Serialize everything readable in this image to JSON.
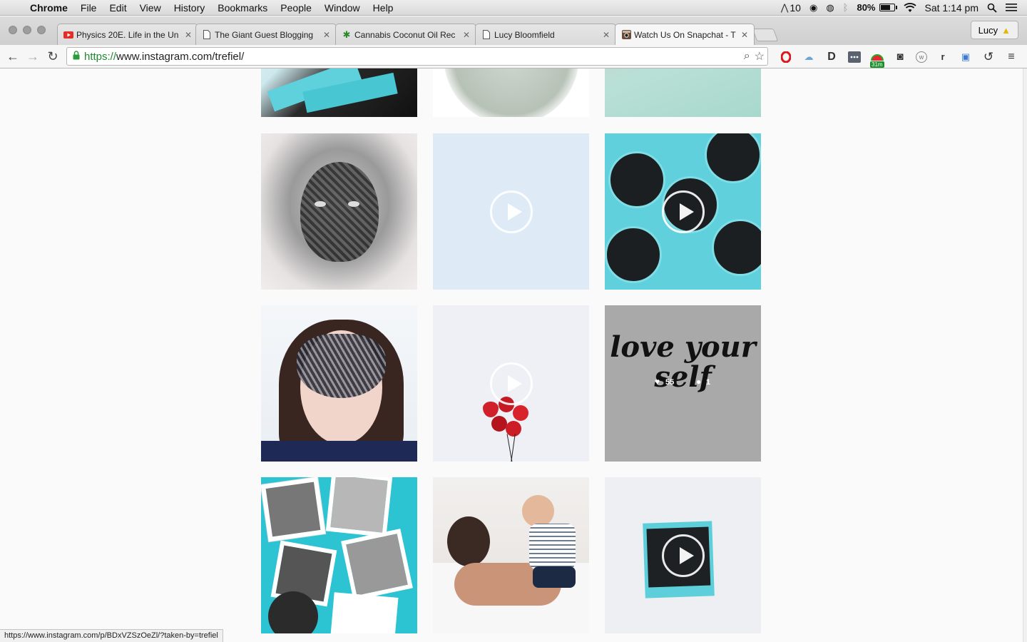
{
  "menubar": {
    "app_name": "Chrome",
    "items": [
      "File",
      "Edit",
      "View",
      "History",
      "Bookmarks",
      "People",
      "Window",
      "Help"
    ],
    "notification_count": "10",
    "battery_percent": "80%",
    "battery_level": 0.8,
    "clock": "Sat 1:14 pm"
  },
  "tabs": [
    {
      "title": "Physics 20E. Life in the Un",
      "favicon": "youtube-icon"
    },
    {
      "title": "The Giant Guest Blogging",
      "favicon": "page-icon"
    },
    {
      "title": "Cannabis Coconut Oil Rec",
      "favicon": "leaf-icon"
    },
    {
      "title": "Lucy Bloomfield",
      "favicon": "page-icon"
    },
    {
      "title": "Watch Us On Snapchat - T",
      "favicon": "instagram-icon"
    }
  ],
  "profile": {
    "name": "Lucy"
  },
  "address": {
    "scheme": "https://",
    "rest": "www.instagram.com/trefiel/"
  },
  "extensions": {
    "badge": "31m"
  },
  "grid": {
    "overlay_likes": "55",
    "overlay_comments": "1",
    "love_text": "love your self"
  },
  "status_url": "https://www.instagram.com/p/BDxVZSzOeZl/?taken-by=trefiel"
}
